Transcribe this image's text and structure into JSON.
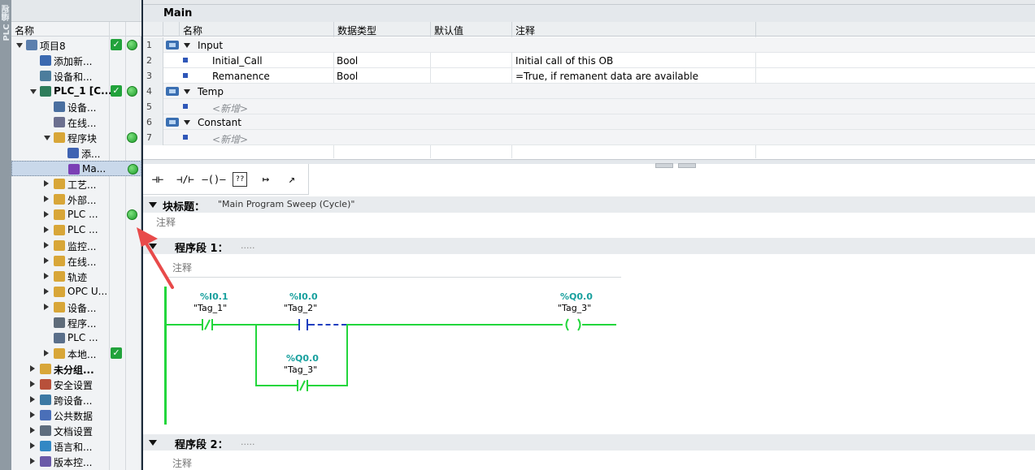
{
  "sidebar_strip": {
    "label": "PLC 编程"
  },
  "tree": {
    "header": "名称",
    "items": [
      {
        "label": "项目8",
        "level": 0,
        "caret": "down",
        "icon": "document-icon",
        "check": true,
        "dot": true
      },
      {
        "label": "添加新...",
        "level": 1,
        "caret": "",
        "icon": "add-device-icon",
        "check": false,
        "dot": false
      },
      {
        "label": "设备和...",
        "level": 1,
        "caret": "",
        "icon": "network-icon",
        "check": false,
        "dot": false
      },
      {
        "label": "PLC_1 [C...",
        "level": 1,
        "caret": "down",
        "icon": "plc-icon",
        "check": true,
        "dot": true,
        "bold": true
      },
      {
        "label": "设备...",
        "level": 2,
        "caret": "",
        "icon": "device-config-icon",
        "check": false,
        "dot": false
      },
      {
        "label": "在线...",
        "level": 2,
        "caret": "",
        "icon": "online-diagnostics-icon",
        "check": false,
        "dot": false
      },
      {
        "label": "程序块",
        "level": 2,
        "caret": "down",
        "icon": "folder-icon",
        "check": false,
        "dot": true
      },
      {
        "label": "添...",
        "level": 3,
        "caret": "",
        "icon": "add-block-icon",
        "check": false,
        "dot": false
      },
      {
        "label": "Ma...",
        "level": 3,
        "caret": "",
        "icon": "ob-block-icon",
        "check": false,
        "dot": true,
        "selected": true
      },
      {
        "label": "工艺...",
        "level": 2,
        "caret": "right",
        "icon": "folder-icon",
        "check": false,
        "dot": false
      },
      {
        "label": "外部...",
        "level": 2,
        "caret": "right",
        "icon": "folder-icon",
        "check": false,
        "dot": false
      },
      {
        "label": "PLC ...",
        "level": 2,
        "caret": "right",
        "icon": "folder-icon",
        "check": false,
        "dot": true
      },
      {
        "label": "PLC ...",
        "level": 2,
        "caret": "right",
        "icon": "folder-icon",
        "check": false,
        "dot": false
      },
      {
        "label": "监控...",
        "level": 2,
        "caret": "right",
        "icon": "folder-icon",
        "check": false,
        "dot": false
      },
      {
        "label": "在线...",
        "level": 2,
        "caret": "right",
        "icon": "folder-icon",
        "check": false,
        "dot": false
      },
      {
        "label": "轨迹",
        "level": 2,
        "caret": "right",
        "icon": "folder-icon",
        "check": false,
        "dot": false
      },
      {
        "label": "OPC U...",
        "level": 2,
        "caret": "right",
        "icon": "folder-icon",
        "check": false,
        "dot": false
      },
      {
        "label": "设备...",
        "level": 2,
        "caret": "right",
        "icon": "folder-icon",
        "check": false,
        "dot": false
      },
      {
        "label": "程序...",
        "level": 2,
        "caret": "",
        "icon": "program-info-icon",
        "check": false,
        "dot": false
      },
      {
        "label": "PLC ...",
        "level": 2,
        "caret": "",
        "icon": "plc-alarm-icon",
        "check": false,
        "dot": false
      },
      {
        "label": "本地...",
        "level": 2,
        "caret": "right",
        "icon": "folder-icon",
        "check": true,
        "dot": false
      },
      {
        "label": "未分组...",
        "level": 1,
        "caret": "right",
        "icon": "folder-icon",
        "check": false,
        "dot": false,
        "bold": true
      },
      {
        "label": "安全设置",
        "level": 1,
        "caret": "right",
        "icon": "security-icon",
        "check": false,
        "dot": false
      },
      {
        "label": "跨设备...",
        "level": 1,
        "caret": "right",
        "icon": "cross-device-icon",
        "check": false,
        "dot": false
      },
      {
        "label": "公共数据",
        "level": 1,
        "caret": "right",
        "icon": "common-data-icon",
        "check": false,
        "dot": false
      },
      {
        "label": "文档设置",
        "level": 1,
        "caret": "right",
        "icon": "doc-settings-icon",
        "check": false,
        "dot": false
      },
      {
        "label": "语言和...",
        "level": 1,
        "caret": "right",
        "icon": "language-icon",
        "check": false,
        "dot": false
      },
      {
        "label": "版本控...",
        "level": 1,
        "caret": "right",
        "icon": "version-control-icon",
        "check": false,
        "dot": false
      }
    ]
  },
  "editor": {
    "block_name": "Main",
    "columns": {
      "name": "名称",
      "datatype": "数据类型",
      "default": "默认值",
      "comment": "注释"
    },
    "rows": [
      {
        "num": "1",
        "kind": "group",
        "name": "Input",
        "datatype": "",
        "default": "",
        "comment": ""
      },
      {
        "num": "2",
        "kind": "var",
        "name": "Initial_Call",
        "datatype": "Bool",
        "default": "",
        "comment": "Initial call of this OB"
      },
      {
        "num": "3",
        "kind": "var",
        "name": "Remanence",
        "datatype": "Bool",
        "default": "",
        "comment": "=True, if remanent data are available"
      },
      {
        "num": "4",
        "kind": "group",
        "name": "Temp",
        "datatype": "",
        "default": "",
        "comment": ""
      },
      {
        "num": "5",
        "kind": "new",
        "name": "<新增>",
        "datatype": "",
        "default": "",
        "comment": ""
      },
      {
        "num": "6",
        "kind": "group",
        "name": "Constant",
        "datatype": "",
        "default": "",
        "comment": ""
      },
      {
        "num": "7",
        "kind": "new",
        "name": "<新增>",
        "datatype": "",
        "default": "",
        "comment": ""
      }
    ]
  },
  "lad_toolbar": {
    "no_contact": "⊣⊢",
    "nc_contact": "⊣/⊢",
    "coil": "–()–",
    "empty_box": "??",
    "open_branch": "↦",
    "close_branch": "↗"
  },
  "block_title": {
    "label": "块标题：",
    "value": "\"Main Program Sweep (Cycle)\"",
    "comment": "注释"
  },
  "network1": {
    "label": "程序段 1：",
    "dots": ".....",
    "comment": "注释",
    "contacts": [
      {
        "addr": "%I0.1",
        "tag": "\"Tag_1\""
      },
      {
        "addr": "%I0.0",
        "tag": "\"Tag_2\""
      },
      {
        "addr": "%Q0.0",
        "tag": "\"Tag_3\""
      }
    ],
    "coil": {
      "addr": "%Q0.0",
      "tag": "\"Tag_3\""
    }
  },
  "network2": {
    "label": "程序段 2：",
    "dots": ".....",
    "comment": "注释"
  },
  "colors": {
    "rail_green": "#22d63c",
    "tag_addr": "#18a09e",
    "arrow_red": "#e84a4a",
    "status_green": "#21a23b"
  }
}
